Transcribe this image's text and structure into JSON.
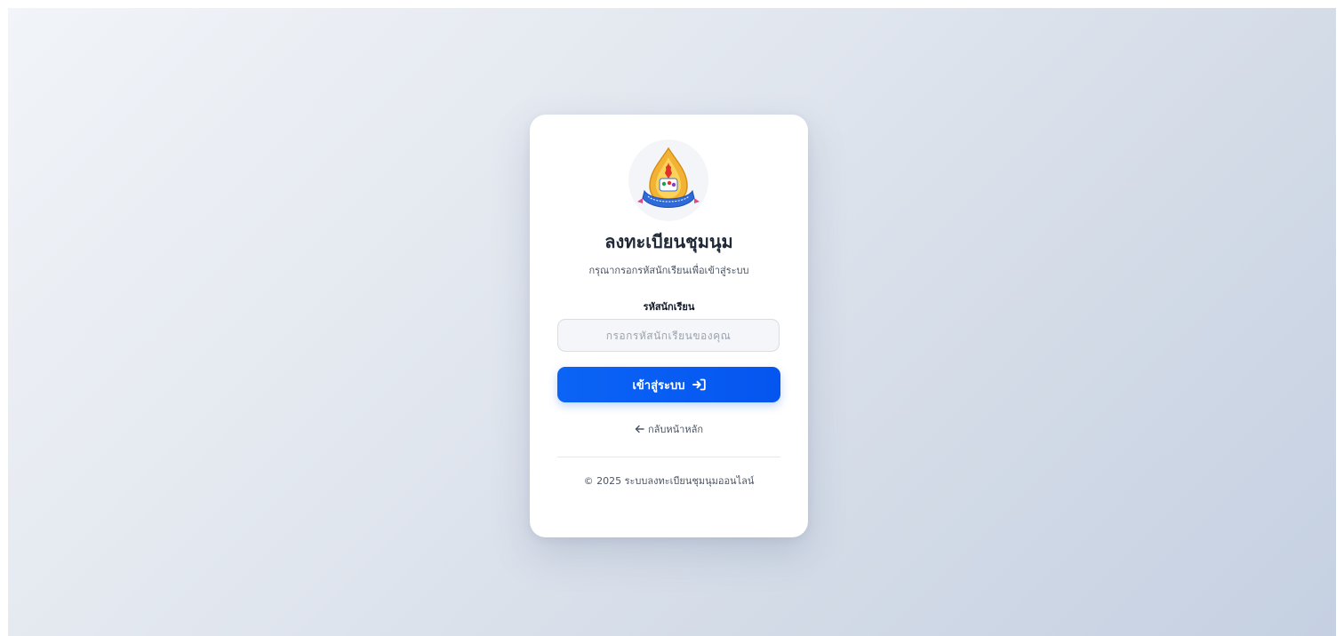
{
  "login": {
    "title": "ลงทะเบียนชุมนุม",
    "subtitle": "กรุณากรอกรหัสนักเรียนเพื่อเข้าสู่ระบบ",
    "field_label": "รหัสนักเรียน",
    "field_placeholder": "กรอกรหัสนักเรียนของคุณ",
    "field_value": "",
    "submit_label": "เข้าสู่ระบบ",
    "submit_icon": "sign-in-icon",
    "back_label": "กลับหน้าหลัก",
    "back_icon": "arrow-left-icon",
    "footer_text": "© 2025 ระบบลงทะเบียนชุมนุมออนไลน์"
  },
  "colors": {
    "primary": "#0b64f5",
    "background_start": "#f1f4f8",
    "background_end": "#c5d0e2",
    "card": "#ffffff"
  }
}
